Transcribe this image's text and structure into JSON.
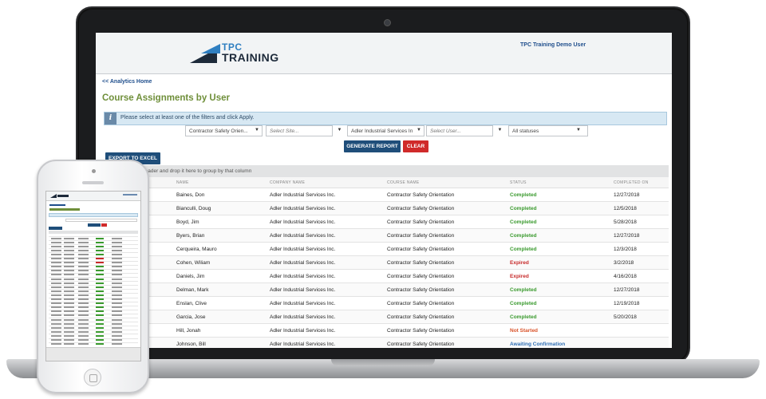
{
  "app": {
    "logo_top": "TPC",
    "logo_bottom": "TRAINING",
    "user_name": "TPC Training Demo User"
  },
  "nav": {
    "back_link": "<< Analytics Home"
  },
  "page": {
    "title": "Course Assignments by User"
  },
  "info_bar": {
    "icon": "i",
    "message": "Please select at least one of the filters and click Apply."
  },
  "filters": {
    "course": "Contractor Safety Orien...",
    "site_placeholder": "Select Site...",
    "company": "Adler Industrial Services In",
    "user_placeholder": "Select User...",
    "status": "All statuses"
  },
  "buttons": {
    "generate": "GENERATE REPORT",
    "clear": "CLEAR",
    "export": "EXPORT TO EXCEL"
  },
  "grid": {
    "group_hint": "header and drop it here to group by that column",
    "columns": [
      "NAME",
      "COMPANY NAME",
      "COURSE NAME",
      "STATUS",
      "COMPLETED ON"
    ],
    "rows": [
      {
        "name": "Baines, Don",
        "company": "Adler Industrial Services Inc.",
        "course": "Contractor Safety Orientation",
        "status": "Completed",
        "completed": "12/27/2018"
      },
      {
        "name": "Bianculli, Doug",
        "company": "Adler Industrial Services Inc.",
        "course": "Contractor Safety Orientation",
        "status": "Completed",
        "completed": "12/5/2018"
      },
      {
        "name": "Boyd, Jim",
        "company": "Adler Industrial Services Inc.",
        "course": "Contractor Safety Orientation",
        "status": "Completed",
        "completed": "5/28/2018"
      },
      {
        "name": "Byers, Brian",
        "company": "Adler Industrial Services Inc.",
        "course": "Contractor Safety Orientation",
        "status": "Completed",
        "completed": "12/27/2018"
      },
      {
        "name": "Cerqueira, Mauro",
        "company": "Adler Industrial Services Inc.",
        "course": "Contractor Safety Orientation",
        "status": "Completed",
        "completed": "12/3/2018"
      },
      {
        "name": "Cohen, Wiliam",
        "company": "Adler Industrial Services Inc.",
        "course": "Contractor Safety Orientation",
        "status": "Expired",
        "completed": "3/2/2018"
      },
      {
        "name": "Daniels, Jim",
        "company": "Adler Industrial Services Inc.",
        "course": "Contractor Safety Orientation",
        "status": "Expired",
        "completed": "4/16/2018"
      },
      {
        "name": "Delman, Mark",
        "company": "Adler Industrial Services Inc.",
        "course": "Contractor Safety Orientation",
        "status": "Completed",
        "completed": "12/27/2018"
      },
      {
        "name": "Enslan, Clive",
        "company": "Adler Industrial Services Inc.",
        "course": "Contractor Safety Orientation",
        "status": "Completed",
        "completed": "12/19/2018"
      },
      {
        "name": "Garcia, Jose",
        "company": "Adler Industrial Services Inc.",
        "course": "Contractor Safety Orientation",
        "status": "Completed",
        "completed": "5/20/2018"
      },
      {
        "name": "Hill, Jonah",
        "company": "Adler Industrial Services Inc.",
        "course": "Contractor Safety Orientation",
        "status": "Not Started",
        "completed": ""
      },
      {
        "name": "Johnson, Bill",
        "company": "Adler Industrial Services Inc.",
        "course": "Contractor Safety Orientation",
        "status": "Awaiting Confirmation",
        "completed": ""
      }
    ]
  },
  "colors": {
    "completed": "#3a9a2e",
    "expired": "#c72a2a",
    "not_started": "#d9532a",
    "awaiting": "#2f6fb5",
    "primary_button": "#1f4e7a",
    "clear_button": "#d02a2a",
    "title_green": "#6f8f3a"
  }
}
